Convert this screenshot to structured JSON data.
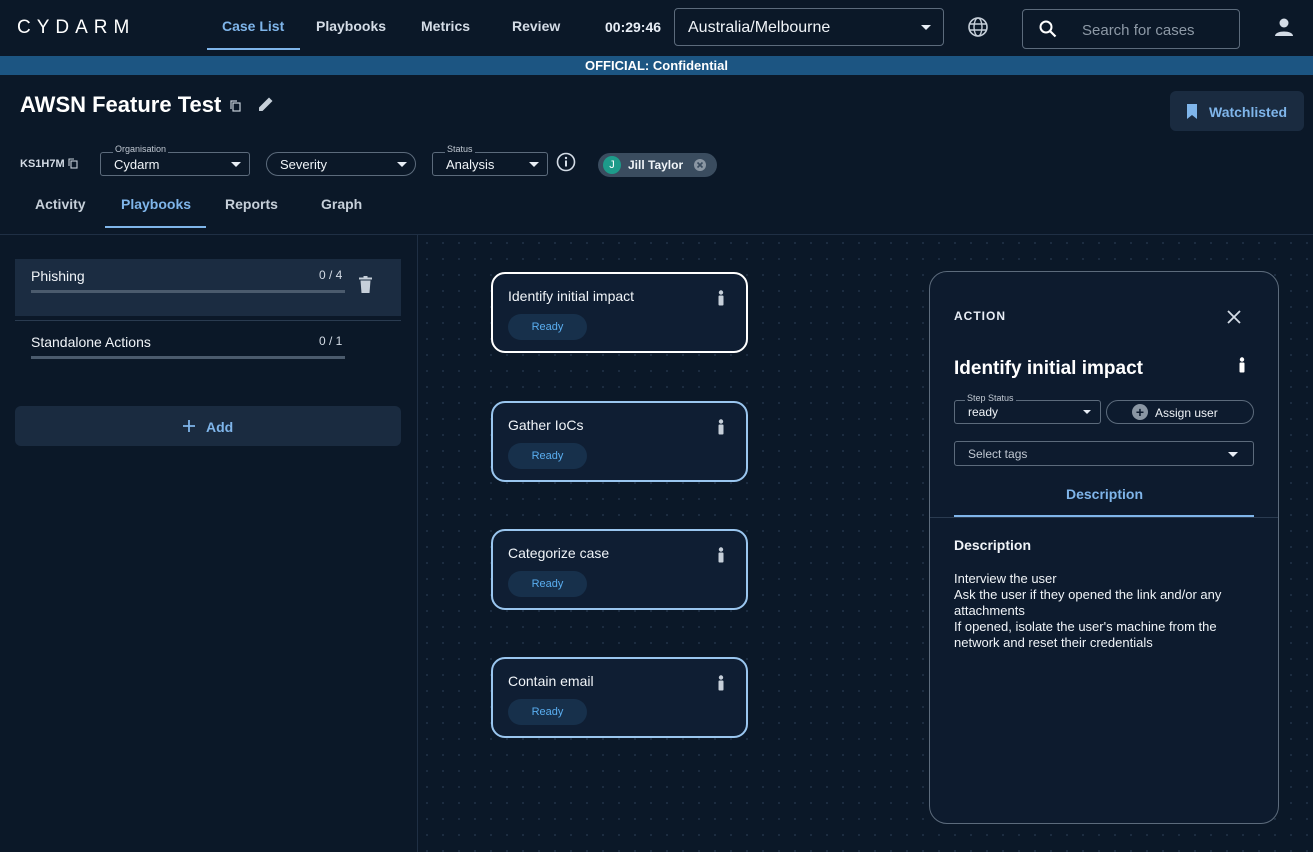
{
  "header": {
    "logo_text": "CYDARM",
    "nav": [
      "Case List",
      "Playbooks",
      "Metrics",
      "Review"
    ],
    "clock": "00:29:46",
    "timezone": "Australia/Melbourne",
    "search_placeholder": "Search for cases"
  },
  "banner": {
    "text": "OFFICIAL: Confidential"
  },
  "case": {
    "title": "AWSN Feature Test",
    "id": "KS1H7M",
    "watch_label": "Watchlisted",
    "organisation": {
      "label": "Organisation",
      "value": "Cydarm"
    },
    "severity": {
      "value": "Severity"
    },
    "status": {
      "label": "Status",
      "value": "Analysis"
    },
    "assignee": {
      "initial": "J",
      "name": "Jill Taylor"
    },
    "tabs": [
      "Activity",
      "Playbooks",
      "Reports",
      "Graph"
    ]
  },
  "playbooks": {
    "items": [
      {
        "name": "Phishing",
        "progress": "0 / 4"
      },
      {
        "name": "Standalone Actions",
        "progress": "0 / 1"
      }
    ],
    "add_label": "Add"
  },
  "actions": [
    {
      "title": "Identify initial impact",
      "status": "Ready"
    },
    {
      "title": "Gather IoCs",
      "status": "Ready"
    },
    {
      "title": "Categorize case",
      "status": "Ready"
    },
    {
      "title": "Contain email",
      "status": "Ready"
    }
  ],
  "panel": {
    "label": "ACTION",
    "title": "Identify initial impact",
    "step_status_label": "Step Status",
    "step_status_value": "ready",
    "assign_label": "Assign user",
    "tags_placeholder": "Select tags",
    "tab": "Description",
    "description_heading": "Description",
    "description_lines": [
      "Interview the user",
      "Ask the user if they opened the link and/or any attachments",
      "If opened, isolate the user's machine from the network and reset their credentials"
    ]
  },
  "colors": {
    "accent": "#7fb5ea",
    "background": "#0b1828",
    "banner": "#1c5582",
    "badge_text": "#5aaef0"
  }
}
